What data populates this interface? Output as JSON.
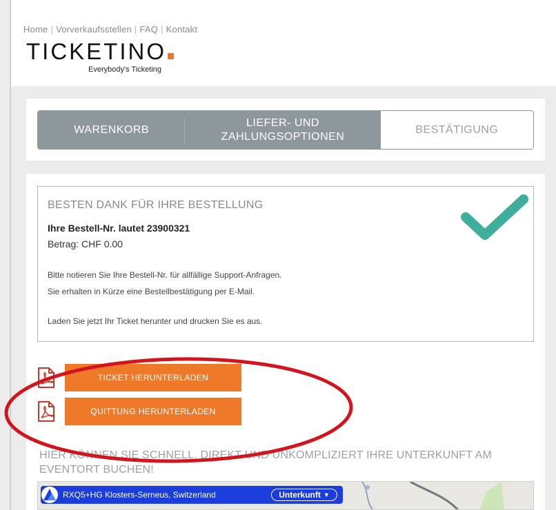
{
  "nav": {
    "links": [
      "Home",
      "Vorverkaufsstellen",
      "FAQ",
      "Kontakt"
    ],
    "separator": "|"
  },
  "brand": {
    "logo": "TICKETINO",
    "tagline": "Everybody's Ticketing",
    "accent_color": "#e8762c"
  },
  "steps": [
    {
      "label": "WARENKORB",
      "state": "done"
    },
    {
      "label": "LIEFER- UND ZAHLUNGSOPTIONEN",
      "state": "done"
    },
    {
      "label": "BESTÄTIGUNG",
      "state": "current"
    }
  ],
  "confirmation": {
    "title": "BESTEN DANK FÜR IHRE BESTELLUNG",
    "order_number": "Ihre Bestell-Nr. lautet 23900321",
    "amount": "Betrag: CHF 0.00",
    "note1": "Bitte notieren Sie Ihre Bestell-Nr. für allfällige Support-Anfragen.",
    "note2": "Sie erhalten in Kürze eine Bestellbestätigung per E-Mail.",
    "note3": "Laden Sie jetzt Ihr Ticket herunter und drucken Sie es aus.",
    "check_color": "#3fae9a"
  },
  "downloads": {
    "ticket_label": "TICKET HERUNTERLADEN",
    "receipt_label": "QUITTUNG HERUNTERLADEN",
    "button_color": "#ee7a29",
    "icon": "pdf-icon"
  },
  "lodging": {
    "text": "HIER KÖNNEN SIE SCHNELL, DIREKT UND UNKOMPLIZIERT IHRE UNTERKUNFT AM EVENTORT BUCHEN!"
  },
  "map": {
    "location": "RXQ5+HG Klosters-Serneus, Switzerland",
    "dropdown_label": "Unterkunft",
    "bar_color": "#1a3ddb"
  },
  "annotation": {
    "ellipse_color": "#d3141c"
  }
}
